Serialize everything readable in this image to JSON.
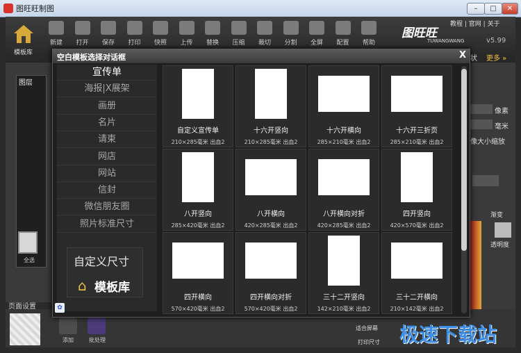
{
  "window": {
    "title": "图旺旺制图",
    "minimize_label": "–",
    "maximize_label": "□",
    "close_label": "✕"
  },
  "toolbar": {
    "home_label": "模板库",
    "tools": [
      {
        "label": "新建",
        "icon": "new-file-icon"
      },
      {
        "label": "打开",
        "icon": "folder-open-icon"
      },
      {
        "label": "保存",
        "icon": "save-icon"
      },
      {
        "label": "打印",
        "icon": "printer-icon"
      },
      {
        "label": "快照",
        "icon": "camera-icon"
      },
      {
        "label": "上传",
        "icon": "upload-icon"
      },
      {
        "label": "替换",
        "icon": "replace-icon"
      },
      {
        "label": "压缩",
        "icon": "compress-icon"
      },
      {
        "label": "裁切",
        "icon": "scissors-icon"
      },
      {
        "label": "分割",
        "icon": "crop-icon"
      },
      {
        "label": "全屏",
        "icon": "monitor-icon"
      },
      {
        "label": "配置",
        "icon": "gear-icon"
      },
      {
        "label": "帮助",
        "icon": "help-icon"
      }
    ],
    "links": [
      "教程",
      "官网",
      "关于"
    ],
    "brand": "图旺旺",
    "brand_sub": "TUWANGWANG",
    "version": "v5.99"
  },
  "background": {
    "layers_title": "图层",
    "select_all": "全选",
    "page_settings": "页面设置",
    "add_label": "添加",
    "batch_label": "批处理",
    "right_labels": {
      "status": "状",
      "more": "更多 »",
      "pixel": "像素",
      "mm": "毫米",
      "scale": "像大小缩放",
      "opacity": "透明度",
      "gradient": "渐变",
      "fit_screen": "适合屏幕",
      "print_size": "打印尺寸"
    }
  },
  "dialog": {
    "title": "空白模板选择对话框",
    "close_label": "X",
    "categories": [
      "宣传单",
      "海报|X展架",
      "画册",
      "名片",
      "请柬",
      "网店",
      "网站",
      "信封",
      "微信朋友圈",
      "照片标准尺寸"
    ],
    "active_category": "宣传单",
    "custom_size_label": "自定义尺寸",
    "library_label": "模板库",
    "templates": [
      {
        "name": "自定义宣传单",
        "dims": "210×285毫米 出血2",
        "orient": "portrait"
      },
      {
        "name": "十六开竖向",
        "dims": "210×285毫米 出血2",
        "orient": "portrait"
      },
      {
        "name": "十六开横向",
        "dims": "285×210毫米 出血2",
        "orient": "landscape"
      },
      {
        "name": "十六开三折页",
        "dims": "285×210毫米 出血2",
        "orient": "landscape"
      },
      {
        "name": "八开竖向",
        "dims": "285×420毫米 出血2",
        "orient": "portrait"
      },
      {
        "name": "八开横向",
        "dims": "420×285毫米 出血2",
        "orient": "landscape"
      },
      {
        "name": "八开横向对折",
        "dims": "420×285毫米 出血2",
        "orient": "landscape"
      },
      {
        "name": "四开竖向",
        "dims": "420×570毫米 出血2",
        "orient": "portrait"
      },
      {
        "name": "四开横向",
        "dims": "570×420毫米 出血2",
        "orient": "landscape"
      },
      {
        "name": "四开横向对折",
        "dims": "570×420毫米 出血2",
        "orient": "landscape"
      },
      {
        "name": "三十二开竖向",
        "dims": "142×210毫米 出血2",
        "orient": "portrait"
      },
      {
        "name": "三十二开横向",
        "dims": "210×142毫米 出血2",
        "orient": "landscape"
      }
    ]
  },
  "watermark": "极速下载站"
}
